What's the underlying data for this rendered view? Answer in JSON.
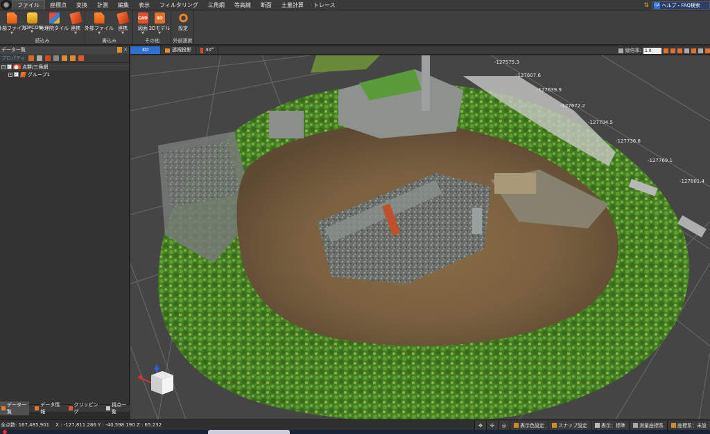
{
  "menu": {
    "items": [
      "ファイル",
      "座標点",
      "変換",
      "計測",
      "編集",
      "表示",
      "フィルタリング",
      "三角網",
      "等高線",
      "断面",
      "土量計算",
      "トレース"
    ],
    "active_index": 0
  },
  "help": {
    "label": "ヘルプ・FAQ検索",
    "badge": "QA"
  },
  "ribbon": {
    "groups": [
      {
        "label": "読込み",
        "buttons": [
          "外部ファイル",
          "TOPCON",
          "地理院タイル",
          "連携"
        ]
      },
      {
        "label": "書込み",
        "buttons": [
          "外部ファイル",
          "連携"
        ]
      },
      {
        "label": "その他",
        "buttons": [
          "図面",
          "3Dモデル"
        ]
      },
      {
        "label": "外部連携",
        "buttons": [
          "設定"
        ]
      }
    ],
    "icon_cad": "CAD",
    "icon_3d": "3D"
  },
  "left_panel": {
    "title": "データ一覧",
    "properties_label": "プロパティ",
    "tree": [
      {
        "label": "点群/三角網",
        "expand": "−",
        "checked": "✓"
      },
      {
        "label": "グループ1",
        "expand": "+",
        "checked": "✓"
      }
    ],
    "tabs": [
      "データ一覧",
      "データ情報",
      "クリッピング",
      "視点一覧"
    ]
  },
  "view": {
    "tabs": [
      "3D",
      "透視投影",
      "30°"
    ],
    "scale_label": "縦倍率:",
    "scale_value": "1.0",
    "axis_labels": [
      "-127575.3",
      "-127607.6",
      "-127639.9",
      "-127672.2",
      "-127704.5",
      "-127736.8",
      "-127769.1",
      "-127801.4"
    ]
  },
  "status": {
    "points": "全点数: 167,485,901",
    "coords": "X : -127,811.286  Y : -40,598.190  Z : 65.232",
    "buttons": [
      "表示色設定",
      "スナップ設定",
      "表示：標準",
      "測量座標系",
      "座標系：未設"
    ]
  }
}
